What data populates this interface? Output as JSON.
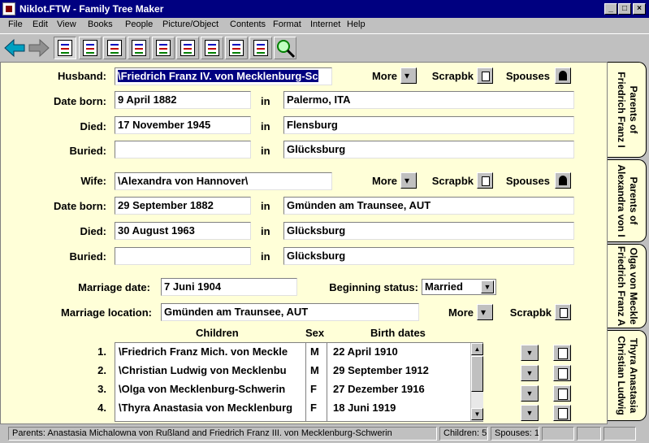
{
  "window": {
    "title": "Niklot.FTW - Family Tree Maker"
  },
  "menu": [
    "File",
    "Edit",
    "View",
    "Books",
    "People",
    "Picture/Object",
    "Contents",
    "Format",
    "Internet",
    "Help"
  ],
  "labels": {
    "husband": "Husband:",
    "wife": "Wife:",
    "date_born": "Date born:",
    "died": "Died:",
    "buried": "Buried:",
    "in": "in",
    "more": "More",
    "scrapbk": "Scrapbk",
    "spouses": "Spouses",
    "marriage_date": "Marriage date:",
    "beginning_status": "Beginning status:",
    "marriage_location": "Marriage location:",
    "children": "Children",
    "sex": "Sex",
    "birth_dates": "Birth dates"
  },
  "husband": {
    "name": "\\Friedrich Franz IV. von Mecklenburg-Sc",
    "born_date": "9 April 1882",
    "born_place": "Palermo, ITA",
    "died_date": "17 November 1945",
    "died_place": "Flensburg",
    "buried_date": "",
    "buried_place": "Glücksburg"
  },
  "wife": {
    "name": "\\Alexandra von Hannover\\",
    "born_date": "29 September 1882",
    "born_place": "Gmünden am Traunsee, AUT",
    "died_date": "30 August 1963",
    "died_place": "Glücksburg",
    "buried_date": "",
    "buried_place": "Glücksburg"
  },
  "marriage": {
    "date": "7 Juni 1904",
    "status": "Married",
    "location": "Gmünden am Traunsee, AUT"
  },
  "children": [
    {
      "num": "1.",
      "name": "\\Friedrich Franz Mich. von Meckle",
      "sex": "M",
      "birth": "22 April 1910"
    },
    {
      "num": "2.",
      "name": "\\Christian Ludwig von Mecklenbu",
      "sex": "M",
      "birth": "29 September 1912"
    },
    {
      "num": "3.",
      "name": "\\Olga von Mecklenburg-Schwerin",
      "sex": "F",
      "birth": "27 Dezember 1916"
    },
    {
      "num": "4.",
      "name": "\\Thyra Anastasia von Mecklenburg",
      "sex": "F",
      "birth": "18 Juni 1919"
    }
  ],
  "tabs": [
    "Parents of\nFriedrich Franz I",
    "Parents of\nAlexandra von I",
    "Olga von Meckle\nFriedrich Franz A",
    "Thyra Anastasia\nChristian Ludwig"
  ],
  "status": {
    "parents": "Parents: Anastasia Michalowna von Rußland and Friedrich Franz III. von Mecklenburg-Schwerin",
    "children": "Children: 5",
    "spouses": "Spouses: 1"
  },
  "icons": {
    "back": "arrow-left-icon",
    "forward": "arrow-right-icon",
    "family_page": "family-group-icon",
    "scrapbook": "scrapbook-icon",
    "spouses": "spouse-user-icon",
    "more": "more-down-arrow-icon",
    "search": "magnifier-icon"
  },
  "colors": {
    "form_bg": "#ffffd8",
    "title_bg": "#000080",
    "selection": "#000080"
  }
}
